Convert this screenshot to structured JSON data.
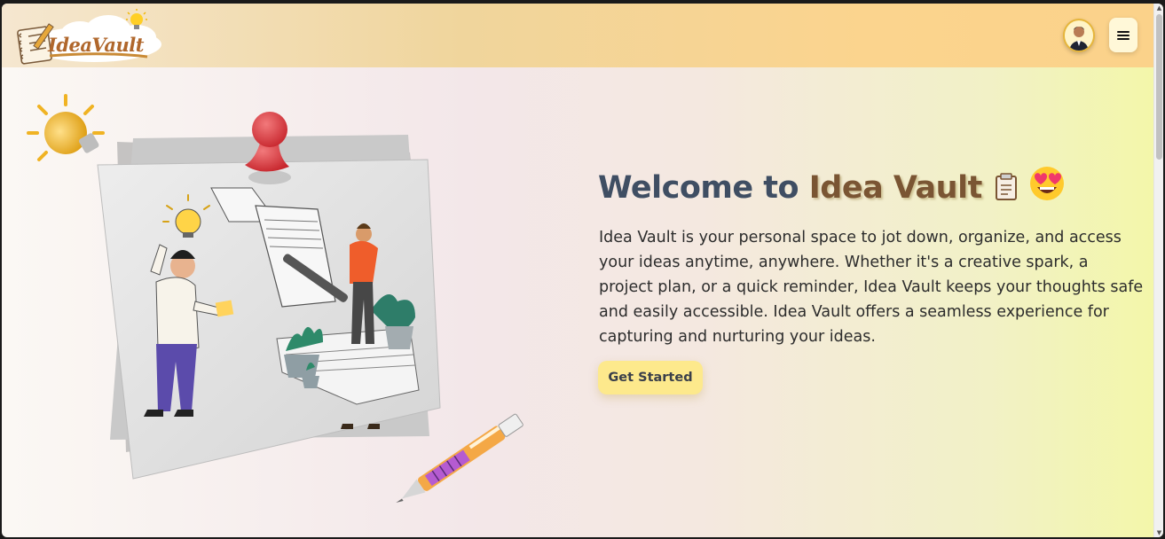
{
  "navbar": {
    "logo_text": "IdeaVault",
    "avatar_alt": "user avatar",
    "menu_icon": "hamburger-menu-icon"
  },
  "hero": {
    "title_prefix": "Welcome to ",
    "title_brand": "Idea Vault",
    "title_icons": [
      "memo-icon",
      "smiling-face-with-heart-eyes-icon"
    ],
    "description": "Idea Vault is your personal space to jot down, organize, and access your ideas anytime, anywhere. Whether it's a creative spark, a project plan, or a quick reminder, Idea Vault keeps your thoughts safe and easily accessible. Idea Vault offers a seamless experience for capturing and nurturing your ideas.",
    "cta_label": "Get Started"
  },
  "colors": {
    "brand_text": "#7a5533",
    "title_text": "#3f4e63",
    "cta_background": "#fde98c",
    "navbar_accent": "#fbd48e"
  }
}
